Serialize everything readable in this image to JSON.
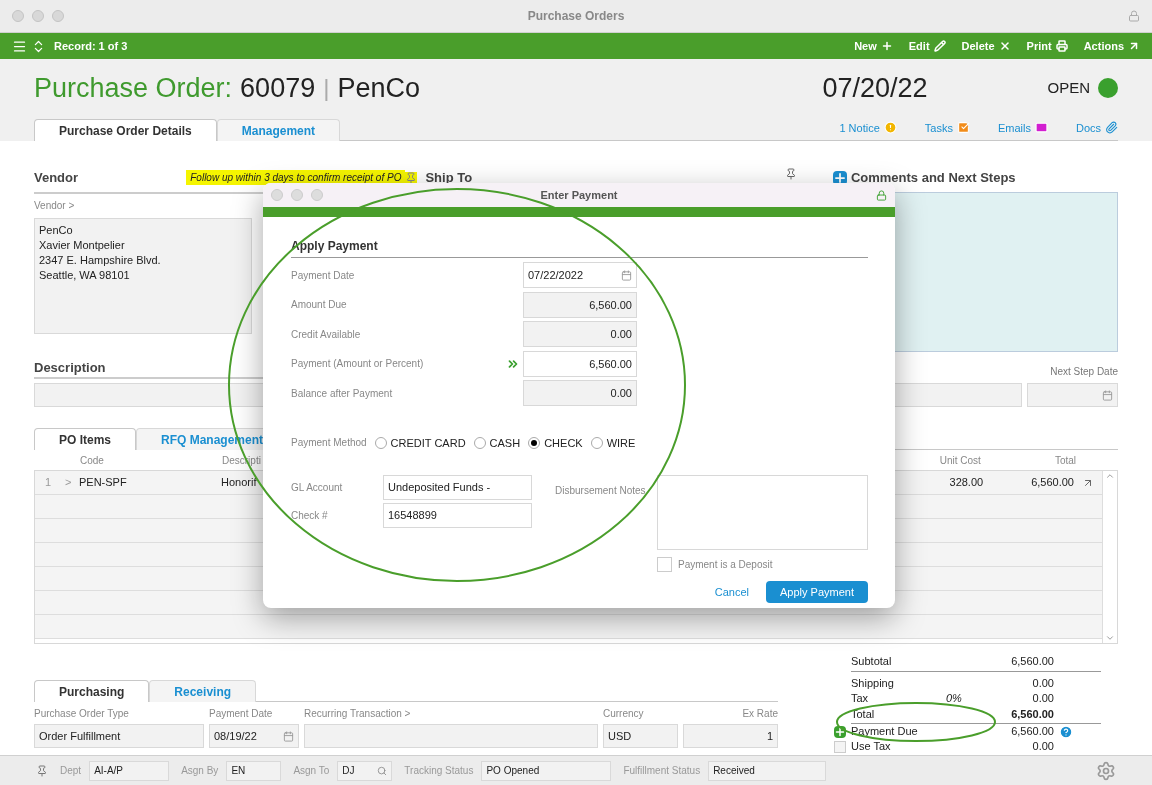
{
  "window": {
    "title": "Purchase Orders"
  },
  "toolbar": {
    "record": "Record: 1 of 3",
    "actions": [
      "New",
      "Edit",
      "Delete",
      "Print",
      "Actions"
    ]
  },
  "header": {
    "label": "Purchase Order:",
    "number": "60079",
    "separator": "|",
    "vendor": "PenCo",
    "date": "07/20/22",
    "status": "OPEN"
  },
  "tabs": [
    {
      "label": "Purchase Order Details",
      "selected": true
    },
    {
      "label": "Management",
      "selected": false
    }
  ],
  "header_links": [
    "1 Notice",
    "Tasks",
    "Emails",
    "Docs"
  ],
  "vendor": {
    "heading": "Vendor",
    "note": "Follow up within 3 days to confirm receipt of PO",
    "link": "Vendor >",
    "address": [
      "PenCo",
      "Xavier Montpelier",
      "2347 E. Hampshire Blvd.",
      "Seattle, WA 98101"
    ]
  },
  "ship_to": {
    "heading": "Ship To"
  },
  "comments": {
    "heading": "Comments and Next Steps",
    "next_step_date_label": "Next Step Date"
  },
  "description": {
    "heading": "Description"
  },
  "items_tabs": [
    {
      "label": "PO Items",
      "selected": true
    },
    {
      "label": "RFQ Management",
      "selected": false
    }
  ],
  "items_table": {
    "columns": [
      "Code",
      "Descripti",
      "Unit Cost",
      "Total"
    ],
    "rows": [
      {
        "number": "1",
        "expander": ">",
        "code": "PEN-SPF",
        "description": "Honorif",
        "unit_cost": "328.00",
        "total": "6,560.00"
      }
    ]
  },
  "totals": [
    {
      "label": "Subtotal",
      "value": "6,560.00",
      "kind": "plain"
    },
    {
      "label": "Shipping",
      "value": "0.00",
      "kind": "plain"
    },
    {
      "label": "Tax",
      "rate": "0%",
      "value": "0.00",
      "kind": "plain"
    },
    {
      "label": "Total",
      "value": "6,560.00",
      "kind": "bold"
    },
    {
      "label": "Payment Due",
      "value": "6,560.00",
      "kind": "add"
    },
    {
      "label": "Use Tax",
      "value": "0.00",
      "kind": "check",
      "checked": false
    }
  ],
  "bottom_tabs": [
    {
      "label": "Purchasing",
      "selected": true
    },
    {
      "label": "Receiving",
      "selected": false
    }
  ],
  "purchasing": {
    "fields": [
      {
        "label": "Purchase Order Type",
        "value": "Order Fulfillment",
        "kind": "text"
      },
      {
        "label": "Payment Date",
        "value": "08/19/22",
        "kind": "date"
      },
      {
        "label": "Recurring Transaction >",
        "kind": "text"
      },
      {
        "label": "Currency",
        "value": "USD",
        "kind": "text"
      },
      {
        "label": "Ex Rate",
        "value": "1",
        "kind": "number"
      }
    ]
  },
  "status_bar": [
    {
      "label": "Dept",
      "value": "AI-A/P"
    },
    {
      "label": "Asgn By",
      "value": "EN"
    },
    {
      "label": "Asgn To",
      "value": "DJ",
      "kind": "search"
    },
    {
      "label": "Tracking Status",
      "value": "PO Opened"
    },
    {
      "label": "Fulfillment Status",
      "value": "Received"
    }
  ],
  "dialog": {
    "title": "Enter Payment",
    "section": "Apply Payment",
    "fields": [
      {
        "label": "Payment Date",
        "value": "07/22/2022",
        "kind": "date"
      },
      {
        "label": "Amount Due",
        "value": "6,560.00",
        "kind": "readonly"
      },
      {
        "label": "Credit Available",
        "value": "0.00",
        "kind": "readonly"
      },
      {
        "label": "Payment (Amount or Percent)",
        "value": "6,560.00",
        "kind": "input"
      },
      {
        "label": "Balance after Payment",
        "value": "0.00",
        "kind": "readonly"
      }
    ],
    "payment_method": {
      "label": "Payment Method",
      "options": [
        {
          "label": "CREDIT CARD",
          "selected": false
        },
        {
          "label": "CASH",
          "selected": false
        },
        {
          "label": "CHECK",
          "selected": true
        },
        {
          "label": "WIRE",
          "selected": false
        }
      ]
    },
    "gl_account": {
      "label": "GL Account",
      "value": "Undeposited Funds -"
    },
    "check_number": {
      "label": "Check #",
      "value": "16548899"
    },
    "notes_label": "Disbursement Notes",
    "deposit": {
      "label": "Payment is a Deposit",
      "checked": false
    },
    "buttons": {
      "cancel": "Cancel",
      "apply": "Apply Payment"
    }
  }
}
